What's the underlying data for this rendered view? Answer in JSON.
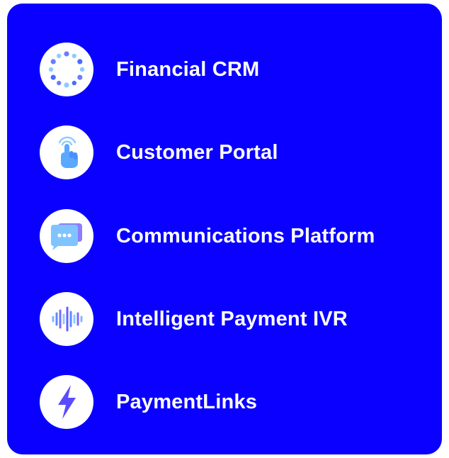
{
  "colors": {
    "panel_background": "#0a00ff",
    "icon_background": "#ffffff",
    "label_text": "#ffffff",
    "icon_accent": "#4a6bff",
    "icon_light": "#8ecbff"
  },
  "menu": {
    "items": [
      {
        "label": "Financial CRM",
        "icon": "dot-ring-icon"
      },
      {
        "label": "Customer Portal",
        "icon": "tap-hand-icon"
      },
      {
        "label": "Communications Platform",
        "icon": "chat-bubble-icon"
      },
      {
        "label": "Intelligent Payment IVR",
        "icon": "sound-wave-icon"
      },
      {
        "label": "PaymentLinks",
        "icon": "lightning-bolt-icon"
      }
    ]
  }
}
